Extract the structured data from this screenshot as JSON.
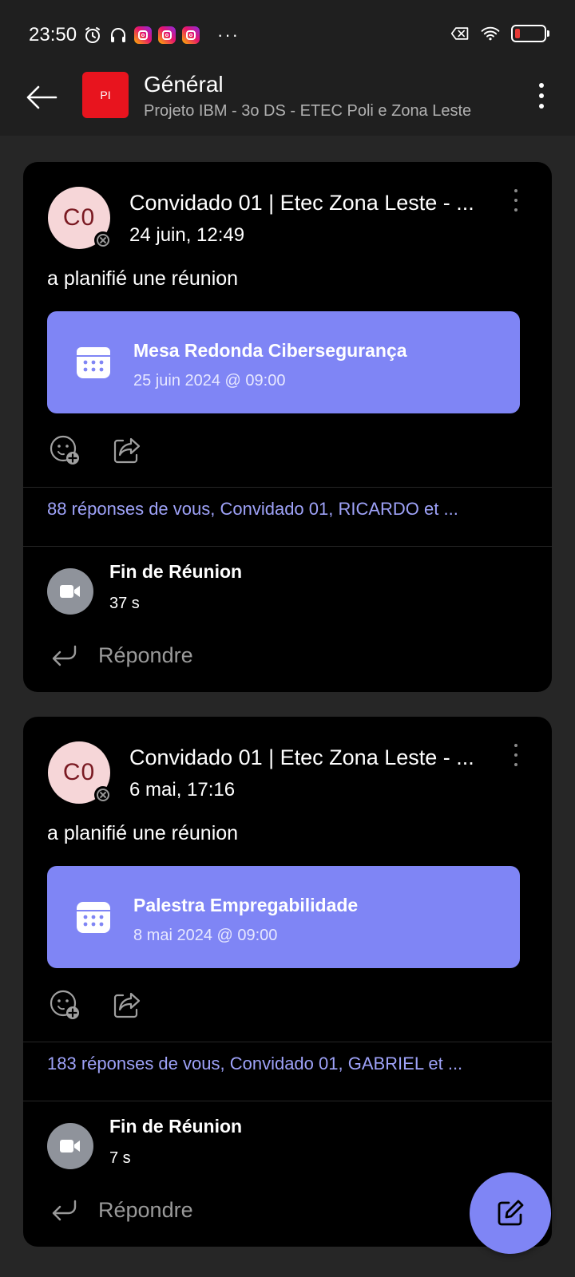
{
  "status_bar": {
    "time": "23:50",
    "more": "···"
  },
  "header": {
    "avatar_initials": "PI",
    "title": "Général",
    "subtitle": "Projeto IBM - 3o DS - ETEC Poli e Zona Leste"
  },
  "posts": [
    {
      "avatar_initials": "C0",
      "author": "Convidado 01 | Etec Zona Leste - ...",
      "timestamp": "24 juin, 12:49",
      "action": "a planifié une réunion",
      "meeting_title": "Mesa Redonda Cibersegurança",
      "meeting_date": "25 juin 2024 @ 09:00",
      "replies": "88 réponses de vous, Convidado 01, RICARDO et ...",
      "end_title": "Fin de Réunion",
      "end_duration": "37 s",
      "reply_label": "Répondre"
    },
    {
      "avatar_initials": "C0",
      "author": "Convidado 01 | Etec Zona Leste - ...",
      "timestamp": "6 mai, 17:16",
      "action": "a planifié une réunion",
      "meeting_title": "Palestra Empregabilidade",
      "meeting_date": "8 mai 2024 @ 09:00",
      "replies": "183 réponses de vous, Convidado 01, GABRIEL et ...",
      "end_title": "Fin de Réunion",
      "end_duration": "7 s",
      "reply_label": "Répondre"
    }
  ],
  "colors": {
    "accent": "#7f85f5",
    "link": "#9ea2f8",
    "team_avatar": "#e8141e",
    "card_bg": "#000000",
    "page_bg": "#262626"
  }
}
